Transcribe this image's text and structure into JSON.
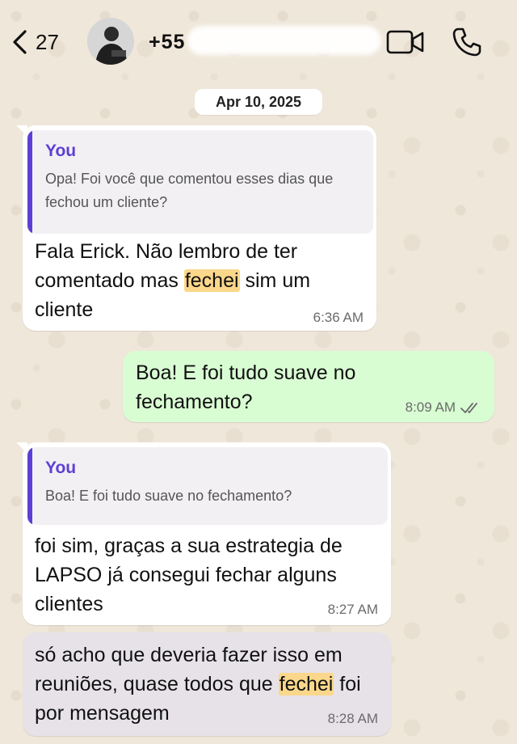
{
  "header": {
    "back_count": "27",
    "contact_name": "+55"
  },
  "date_chip": "Apr 10, 2025",
  "messages": [
    {
      "quote_author": "You",
      "quote_text": "Opa! Foi você que comentou esses dias que fechou um cliente?",
      "text_before": "Fala Erick. Não lembro de ter comentado mas ",
      "highlight": "fechei",
      "text_after": " sim um cliente",
      "time": "6:36 AM"
    },
    {
      "text": "Boa! E foi tudo suave no fechamento?",
      "time": "8:09 AM"
    },
    {
      "quote_author": "You",
      "quote_text": "Boa! E foi tudo suave no fechamento?",
      "text": "foi sim, graças a sua estrategia de LAPSO já consegui fechar alguns clientes",
      "time": "8:27 AM"
    },
    {
      "text_before": "só acho que deveria fazer isso em reuniões, quase todos que ",
      "highlight": "fechei",
      "text_after": " foi por mensagem",
      "time": "8:28 AM"
    }
  ],
  "icons": {
    "back": "chevron-left-icon",
    "video": "video-camera-icon",
    "call": "phone-icon",
    "read_receipt": "double-check-icon"
  },
  "colors": {
    "accent": "#5d3fd3",
    "outgoing_bubble": "#d9fdd3",
    "highlight": "#fbd78b"
  }
}
